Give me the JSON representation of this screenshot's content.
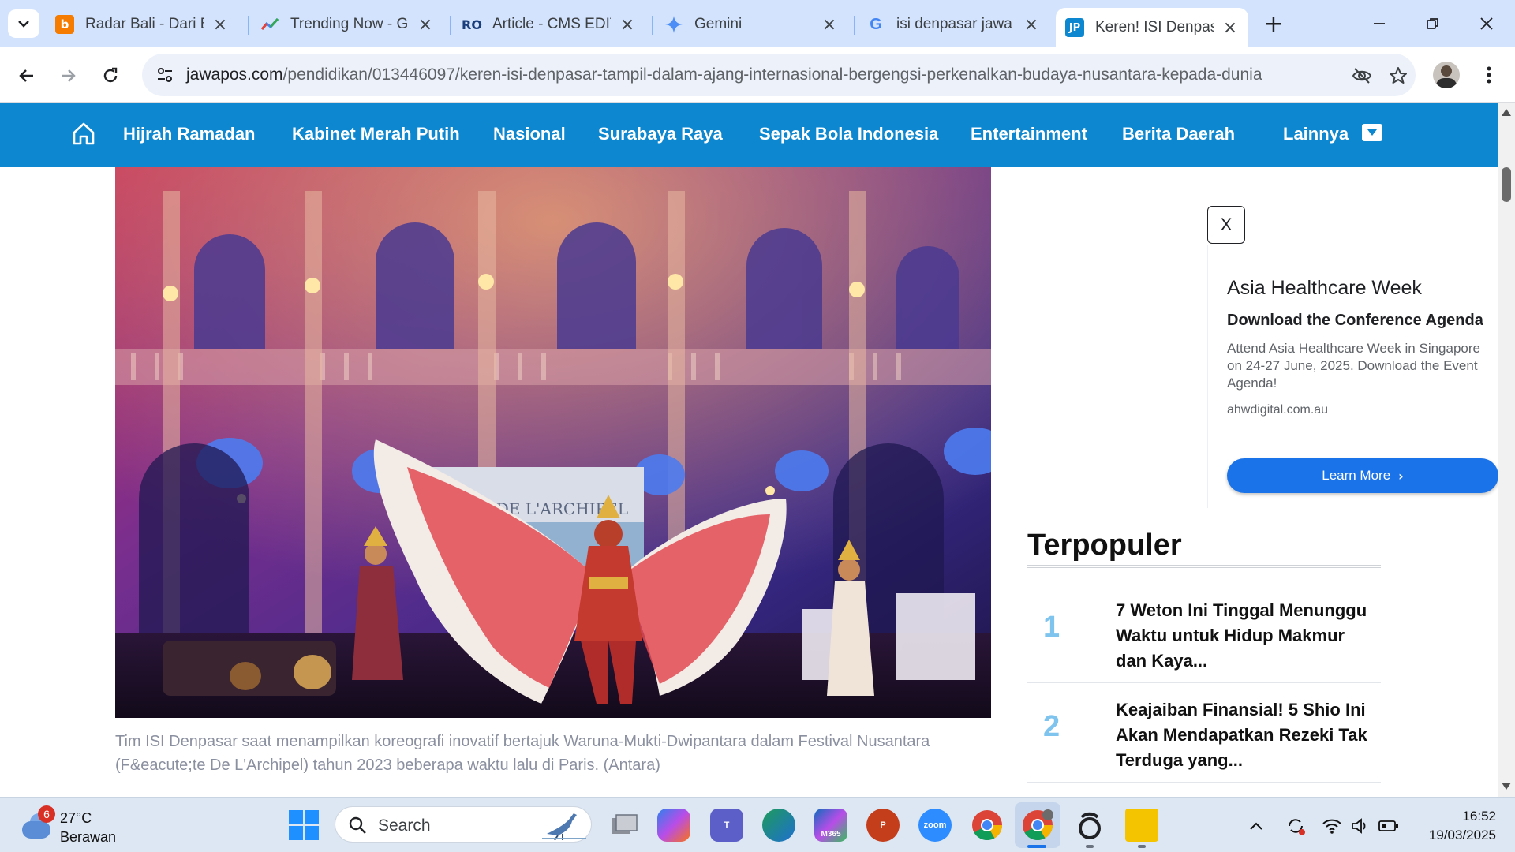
{
  "browser": {
    "tabs": [
      {
        "title": "Radar Bali - Dari Bali",
        "favicon": "b",
        "favicon_color": "#f57c00"
      },
      {
        "title": "Trending Now - Google Trends",
        "favicon": "trends-icon",
        "favicon_color": "#4285f4"
      },
      {
        "title": "Article - CMS EDITOR",
        "favicon": "RO",
        "favicon_color": "#1a3d7c"
      },
      {
        "title": "Gemini",
        "favicon": "gemini-icon",
        "favicon_color": "#4c8df6"
      },
      {
        "title": "isi denpasar jawa pos",
        "favicon": "G",
        "favicon_color": "#4285f4"
      },
      {
        "title": "Keren! ISI Denpasar",
        "favicon": "JP",
        "favicon_color": "#0c87d0",
        "active": true
      }
    ],
    "url_host": "jawapos.com",
    "url_path": "/pendidikan/013446097/keren-isi-denpasar-tampil-dalam-ajang-internasional-bergengsi-perkenalkan-budaya-nusantara-kepada-dunia"
  },
  "site_nav": {
    "items": [
      "Hijrah Ramadan",
      "Kabinet Merah Putih",
      "Nasional",
      "Surabaya Raya",
      "Sepak Bola Indonesia",
      "Entertainment",
      "Berita Daerah",
      "Lainnya"
    ],
    "color": "#0c87d0"
  },
  "article": {
    "photo_banner": "FÊTE DE L'ARCHIPEL",
    "caption": "Tim ISI Denpasar saat menampilkan koreografi inovatif bertajuk Waruna-Mukti-Dwipantara dalam Festival Nusantara (F&eacute;te De L'Archipel) tahun 2023 beberapa waktu lalu di Paris. (Antara)"
  },
  "ad": {
    "close_label": "X",
    "title": "Asia Healthcare Week",
    "subtitle": "Download the Conference Agenda",
    "description": "Attend Asia Healthcare Week in Singapore on 24-27 June, 2025. Download the Event Agenda!",
    "domain": "ahwdigital.com.au",
    "cta": "Learn More"
  },
  "popular": {
    "heading": "Terpopuler",
    "items": [
      {
        "rank": "1",
        "title": "7 Weton Ini Tinggal Menunggu Waktu untuk Hidup Makmur dan Kaya..."
      },
      {
        "rank": "2",
        "title": "Keajaiban Finansial! 5 Shio Ini Akan Mendapatkan Rezeki Tak Terduga yang..."
      }
    ]
  },
  "taskbar": {
    "weather_badge": "6",
    "temperature": "27°C",
    "condition": "Berawan",
    "search_label": "Search",
    "m365_label": "M365",
    "zoom_label": "zoom",
    "time": "16:52",
    "date": "19/03/2025"
  }
}
